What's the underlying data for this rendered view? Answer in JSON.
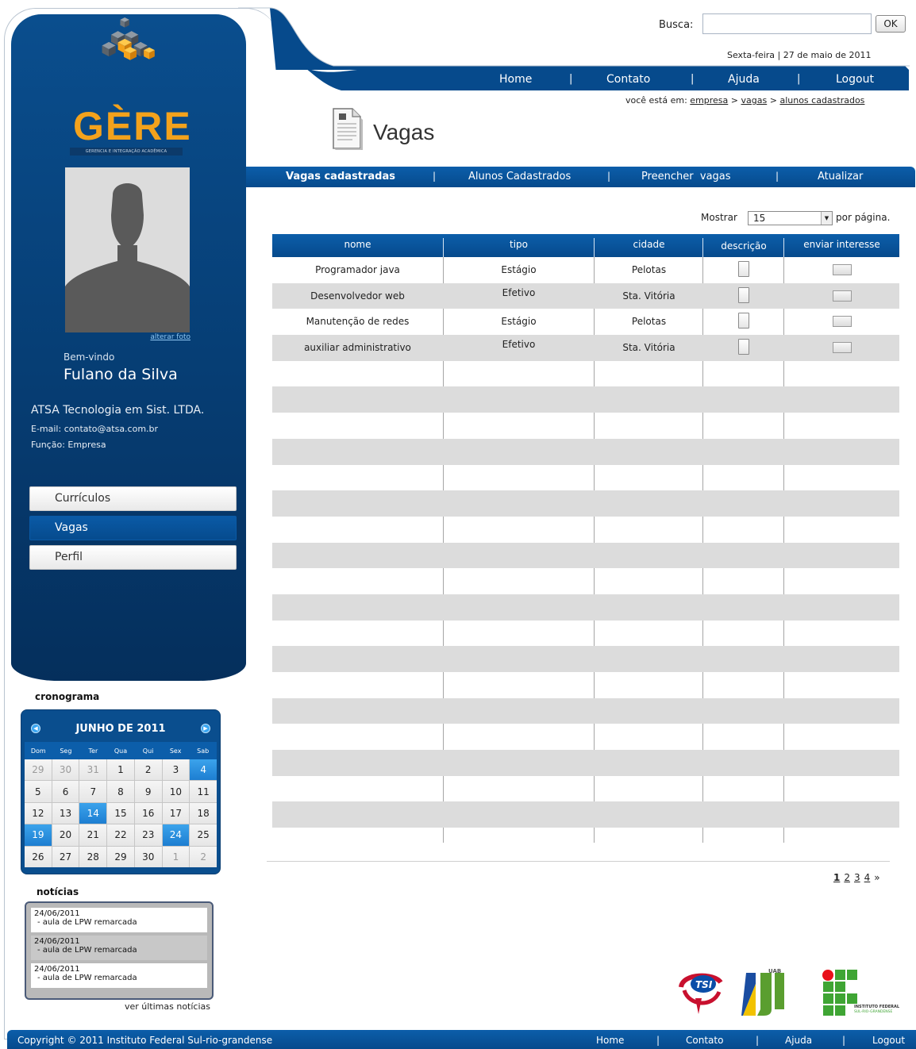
{
  "header": {
    "search_label": "Busca:",
    "search_value": "",
    "ok_label": "OK",
    "date": "Sexta-feira | 27 de maio de 2011",
    "nav": [
      "Home",
      "Contato",
      "Ajuda",
      "Logout"
    ],
    "breadcrumb_prefix": "você está em:",
    "breadcrumb": [
      "empresa",
      "vagas",
      "alunos cadastrados"
    ],
    "breadcrumb_sep": ">"
  },
  "logo": {
    "title": "GÈRE",
    "subtitle": "GERENCIA E INTEGRAÇÃO ACADÊMICA"
  },
  "profile": {
    "photo_link": "alterar foto",
    "welcome": "Bem-vindo",
    "name": "Fulano da Silva",
    "company": "ATSA Tecnologia em Sist. LTDA.",
    "email": "E-mail: contato@atsa.com.br",
    "role": "Função: Empresa"
  },
  "menu": [
    {
      "label": "Currículos",
      "active": false
    },
    {
      "label": "Vagas",
      "active": true
    },
    {
      "label": "Perfil",
      "active": false
    }
  ],
  "calendar": {
    "section_title": "cronograma",
    "month": "JUNHO DE 2011",
    "dow": [
      "Dom",
      "Seg",
      "Ter",
      "Qua",
      "Qui",
      "Sex",
      "Sab"
    ],
    "days": [
      {
        "d": "29",
        "m": true
      },
      {
        "d": "30",
        "m": true
      },
      {
        "d": "31",
        "m": true
      },
      {
        "d": "1"
      },
      {
        "d": "2"
      },
      {
        "d": "3"
      },
      {
        "d": "4",
        "h": true
      },
      {
        "d": "5"
      },
      {
        "d": "6"
      },
      {
        "d": "7"
      },
      {
        "d": "8"
      },
      {
        "d": "9"
      },
      {
        "d": "10"
      },
      {
        "d": "11"
      },
      {
        "d": "12"
      },
      {
        "d": "13"
      },
      {
        "d": "14",
        "h": true
      },
      {
        "d": "15"
      },
      {
        "d": "16"
      },
      {
        "d": "17"
      },
      {
        "d": "18"
      },
      {
        "d": "19",
        "h": true
      },
      {
        "d": "20"
      },
      {
        "d": "21"
      },
      {
        "d": "22"
      },
      {
        "d": "23"
      },
      {
        "d": "24",
        "h": true
      },
      {
        "d": "25"
      },
      {
        "d": "26"
      },
      {
        "d": "27"
      },
      {
        "d": "28"
      },
      {
        "d": "29"
      },
      {
        "d": "30"
      },
      {
        "d": "1",
        "m": true
      },
      {
        "d": "2",
        "m": true
      }
    ]
  },
  "news": {
    "section_title": "notícias",
    "items": [
      {
        "date": "24/06/2011",
        "text": "- aula de LPW remarcada"
      },
      {
        "date": "24/06/2011",
        "text": "- aula de LPW remarcada"
      },
      {
        "date": "24/06/2011",
        "text": "- aula de LPW remarcada"
      }
    ],
    "more": "ver últimas notícias"
  },
  "page": {
    "title": "Vagas",
    "tabs": [
      "Vagas cadastradas",
      "Alunos Cadastrados",
      "Preencher  vagas",
      "Atualizar"
    ],
    "show_label": "Mostrar",
    "show_value": "15",
    "per_page": "por página."
  },
  "table": {
    "headers": [
      "nome",
      "tipo",
      "cidade",
      "descrição",
      "enviar interesse"
    ],
    "rows": [
      {
        "nome": "Programador java",
        "tipo": "Estágio",
        "cidade": "Pelotas"
      },
      {
        "nome": "Desenvolvedor web",
        "tipo": "Efetivo",
        "cidade": "Sta. Vitória"
      },
      {
        "nome": "Manutenção de redes",
        "tipo": "Estágio",
        "cidade": "Pelotas"
      },
      {
        "nome": "auxiliar administrativo",
        "tipo": "Efetivo",
        "cidade": "Sta. Vitória"
      }
    ],
    "empty_rows": 19
  },
  "pager": {
    "pages": [
      "1",
      "2",
      "3",
      "4"
    ],
    "next": "»",
    "current": "1"
  },
  "footer": {
    "copyright": "Copyright © 2011 Instituto Federal Sul-rio-grandense",
    "nav": [
      "Home",
      "Contato",
      "Ajuda",
      "Logout"
    ]
  },
  "partner_logos": {
    "tsi": "TSI",
    "uab": "UAB",
    "if_line1": "INSTITUTO FEDERAL",
    "if_line2": "SUL-RIO-GRANDENSE"
  },
  "colors": {
    "primary": "#064a8c",
    "accent": "#f3a21c",
    "highlight": "#1d7ed1",
    "stripe": "#dcdcdc"
  }
}
